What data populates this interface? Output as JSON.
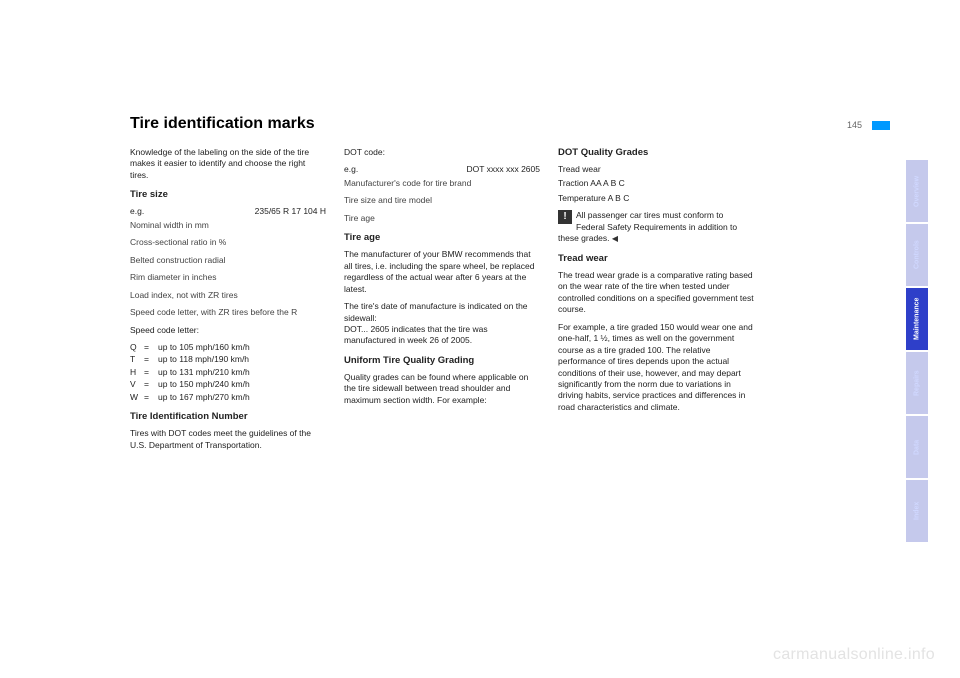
{
  "page": {
    "title": "Tire identification marks",
    "number": "145"
  },
  "col1": {
    "intro": "Knowledge of the labeling on the side of the tire makes it easier to identify and choose the right tires.",
    "tireSizeHeading": "Tire size",
    "specExample": {
      "label": "e.g.",
      "value": "235/65  R  17  104 H"
    },
    "specs": [
      "Nominal width in mm",
      "Cross-sectional ratio in %",
      "Belted construction radial",
      "Rim diameter in inches",
      "Load index, not with ZR tires",
      "Speed code letter, with ZR tires before the R"
    ],
    "speedCodeHeading": "Speed code letter:",
    "speedCodes": [
      {
        "letter": "Q",
        "desc": "up to 105 mph/160 km/h"
      },
      {
        "letter": "T",
        "desc": "up to 118 mph/190 km/h"
      },
      {
        "letter": "H",
        "desc": "up to 131 mph/210 km/h"
      },
      {
        "letter": "V",
        "desc": "up to 150 mph/240 km/h"
      },
      {
        "letter": "W",
        "desc": "up to 167 mph/270 km/h"
      }
    ],
    "tinHeading": "Tire Identification Number",
    "tinText": "Tires with DOT codes meet the guidelines of the U.S. Department of Transportation."
  },
  "col2": {
    "dotHeading": "DOT code:",
    "dotExample": {
      "label": "e.g.",
      "value": "DOT xxxx xxx 2605"
    },
    "dotSpecs": [
      "Manufacturer's code for tire brand",
      "Tire size and tire model",
      "Tire age"
    ],
    "tireAgeHeading": "Tire age",
    "tireAgeP1": "The manufacturer of your BMW recommends that all tires, i.e. including the spare wheel, be replaced regardless of the actual wear after 6 years at the latest.",
    "tireAgeP2": "The tire's date of manufacture is indicated on the sidewall:",
    "tireAgeP3": "DOT... 2605 indicates that the tire was manufactured in week 26 of 2005.",
    "utqgHeading": "Uniform Tire Quality Grading",
    "utqgText": "Quality grades can be found where applicable on the tire sidewall between tread shoulder and maximum section width. For example:"
  },
  "col3": {
    "dqgHeading": "DOT Quality Grades",
    "dqg1": "Tread wear",
    "dqg2": "Traction AA A B C",
    "dqg3": "Temperature A B C",
    "warnText": "All passenger car tires must conform to Federal Safety Requirements in addition to these grades.",
    "treadHeading": "Tread wear",
    "treadP1": "The tread wear grade is a comparative rating based on the wear rate of the tire when tested under controlled conditions on a specified government test course.",
    "treadP2": "For example, a tire graded 150 would wear one and one-half, 1 ½, times as well on the government course as a tire graded 100. The relative performance of tires depends upon the actual conditions of their use, however, and may depart significantly from the norm due to variations in driving habits, service practices and differences in road characteristics and climate."
  },
  "tabs": [
    {
      "label": "Overview",
      "active": false
    },
    {
      "label": "Controls",
      "active": false
    },
    {
      "label": "Maintenance",
      "active": true
    },
    {
      "label": "Repairs",
      "active": false
    },
    {
      "label": "Data",
      "active": false
    },
    {
      "label": "Index",
      "active": false
    }
  ],
  "watermark": "carmanualsonline.info"
}
